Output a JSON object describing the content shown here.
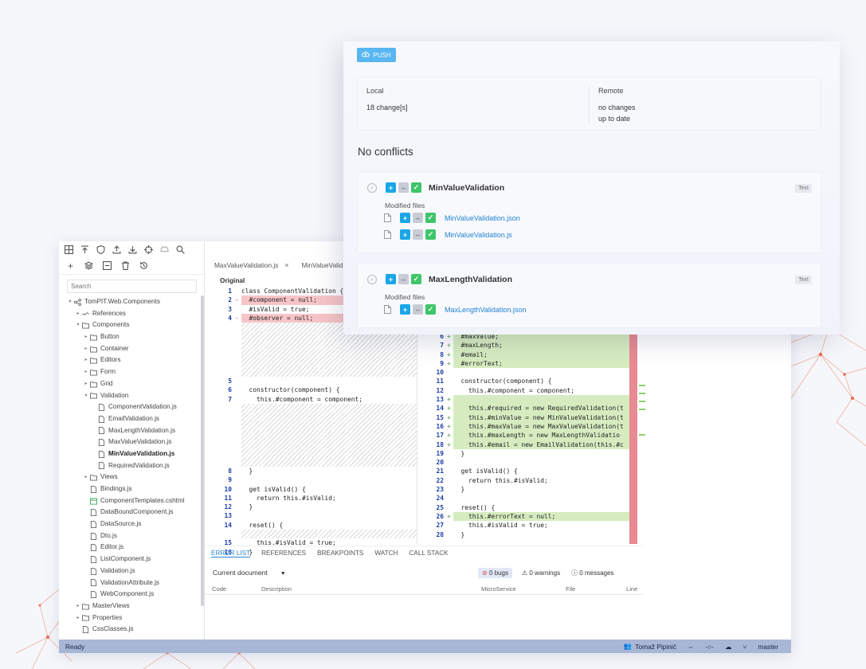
{
  "ide": {
    "search_placeholder": "Search",
    "tree": [
      {
        "label": "TomPIT.Web.Components",
        "indent": 0,
        "caret": "▾",
        "icon": "share-icon"
      },
      {
        "label": "References",
        "indent": 1,
        "caret": "▸",
        "icon": "link-icon"
      },
      {
        "label": "Components",
        "indent": 1,
        "caret": "▾",
        "icon": "folder-icon"
      },
      {
        "label": "Button",
        "indent": 2,
        "caret": "▸",
        "icon": "folder-icon"
      },
      {
        "label": "Container",
        "indent": 2,
        "caret": "▸",
        "icon": "folder-icon"
      },
      {
        "label": "Editors",
        "indent": 2,
        "caret": "▸",
        "icon": "folder-icon"
      },
      {
        "label": "Form",
        "indent": 2,
        "caret": "▸",
        "icon": "folder-icon"
      },
      {
        "label": "Grid",
        "indent": 2,
        "caret": "▸",
        "icon": "folder-icon"
      },
      {
        "label": "Validation",
        "indent": 2,
        "caret": "▾",
        "icon": "folder-icon"
      },
      {
        "label": "ComponentValidation.js",
        "indent": 3,
        "caret": "",
        "icon": "file-icon"
      },
      {
        "label": "EmailValidation.js",
        "indent": 3,
        "caret": "",
        "icon": "file-icon"
      },
      {
        "label": "MaxLengthValidation.js",
        "indent": 3,
        "caret": "",
        "icon": "file-icon"
      },
      {
        "label": "MaxValueValidation.js",
        "indent": 3,
        "caret": "",
        "icon": "file-icon"
      },
      {
        "label": "MinValueValidation.js",
        "indent": 3,
        "caret": "",
        "icon": "file-icon",
        "bold": true
      },
      {
        "label": "RequiredValidation.js",
        "indent": 3,
        "caret": "",
        "icon": "file-icon"
      },
      {
        "label": "Views",
        "indent": 2,
        "caret": "▸",
        "icon": "folder-icon"
      },
      {
        "label": "Bindings.js",
        "indent": 2,
        "caret": "",
        "icon": "file-icon"
      },
      {
        "label": "ComponentTemplates.cshtml",
        "indent": 2,
        "caret": "",
        "icon": "template-icon"
      },
      {
        "label": "DataBoundComponent.js",
        "indent": 2,
        "caret": "",
        "icon": "file-icon"
      },
      {
        "label": "DataSource.js",
        "indent": 2,
        "caret": "",
        "icon": "file-icon"
      },
      {
        "label": "Dto.js",
        "indent": 2,
        "caret": "",
        "icon": "file-icon"
      },
      {
        "label": "Editor.js",
        "indent": 2,
        "caret": "",
        "icon": "file-icon"
      },
      {
        "label": "ListComponent.js",
        "indent": 2,
        "caret": "",
        "icon": "file-icon"
      },
      {
        "label": "Validation.js",
        "indent": 2,
        "caret": "",
        "icon": "file-icon"
      },
      {
        "label": "ValidationAttribute.js",
        "indent": 2,
        "caret": "",
        "icon": "file-icon"
      },
      {
        "label": "WebComponent.js",
        "indent": 2,
        "caret": "",
        "icon": "file-icon"
      },
      {
        "label": "MasterViews",
        "indent": 1,
        "caret": "▸",
        "icon": "folder-icon"
      },
      {
        "label": "Properties",
        "indent": 1,
        "caret": "▸",
        "icon": "folder-icon"
      },
      {
        "label": "CssClasses.js",
        "indent": 1,
        "caret": "",
        "icon": "file-icon"
      }
    ],
    "tabs": [
      {
        "label": "MaxValueValidation.js",
        "close": "×"
      },
      {
        "label": "MinValueValida"
      }
    ],
    "original_label": "Original",
    "left_code": [
      {
        "n": "1",
        "mark": "",
        "t": "class ComponentValidation {",
        "type": "normal"
      },
      {
        "n": "2",
        "mark": "-",
        "t": "  #component = null;",
        "type": "del"
      },
      {
        "n": "3",
        "mark": "",
        "t": "  #isValid = true;",
        "type": "normal"
      },
      {
        "n": "4",
        "mark": "-",
        "t": "  #observer = null;",
        "type": "del"
      },
      {
        "n": "",
        "mark": "",
        "t": "",
        "type": "hatch"
      },
      {
        "n": "",
        "mark": "",
        "t": "",
        "type": "hatch"
      },
      {
        "n": "",
        "mark": "",
        "t": "",
        "type": "hatch"
      },
      {
        "n": "",
        "mark": "",
        "t": "",
        "type": "hatch"
      },
      {
        "n": "",
        "mark": "",
        "t": "",
        "type": "hatch"
      },
      {
        "n": "",
        "mark": "",
        "t": "",
        "type": "hatch"
      },
      {
        "n": "5",
        "mark": "",
        "t": "",
        "type": "normal"
      },
      {
        "n": "6",
        "mark": "",
        "t": "  constructor(component) {",
        "type": "normal"
      },
      {
        "n": "7",
        "mark": "",
        "t": "    this.#component = component;",
        "type": "normal"
      },
      {
        "n": "",
        "mark": "",
        "t": "",
        "type": "hatch"
      },
      {
        "n": "",
        "mark": "",
        "t": "",
        "type": "hatch"
      },
      {
        "n": "",
        "mark": "",
        "t": "",
        "type": "hatch"
      },
      {
        "n": "",
        "mark": "",
        "t": "",
        "type": "hatch"
      },
      {
        "n": "",
        "mark": "",
        "t": "",
        "type": "hatch"
      },
      {
        "n": "",
        "mark": "",
        "t": "",
        "type": "hatch"
      },
      {
        "n": "",
        "mark": "",
        "t": "",
        "type": "hatch"
      },
      {
        "n": "8",
        "mark": "",
        "t": "  }",
        "type": "normal"
      },
      {
        "n": "9",
        "mark": "",
        "t": "",
        "type": "normal"
      },
      {
        "n": "10",
        "mark": "",
        "t": "  get isValid() {",
        "type": "normal"
      },
      {
        "n": "11",
        "mark": "",
        "t": "    return this.#isValid;",
        "type": "normal"
      },
      {
        "n": "12",
        "mark": "",
        "t": "  }",
        "type": "normal"
      },
      {
        "n": "13",
        "mark": "",
        "t": "",
        "type": "normal"
      },
      {
        "n": "14",
        "mark": "",
        "t": "  reset() {",
        "type": "normal"
      },
      {
        "n": "",
        "mark": "",
        "t": "",
        "type": "hatch"
      },
      {
        "n": "15",
        "mark": "",
        "t": "    this.#isValid = true;",
        "type": "normal"
      },
      {
        "n": "16",
        "mark": "",
        "t": "  }",
        "type": "normal"
      }
    ],
    "right_code": [
      {
        "n": "6",
        "mark": "+",
        "t": "  #maxValue;",
        "type": "add"
      },
      {
        "n": "7",
        "mark": "+",
        "t": "  #maxLength;",
        "type": "add"
      },
      {
        "n": "8",
        "mark": "+",
        "t": "  #email;",
        "type": "add"
      },
      {
        "n": "9",
        "mark": "+",
        "t": "  #errorText;",
        "type": "add"
      },
      {
        "n": "10",
        "mark": "",
        "t": "",
        "type": "normal"
      },
      {
        "n": "11",
        "mark": "",
        "t": "  constructor(component) {",
        "type": "normal"
      },
      {
        "n": "12",
        "mark": "",
        "t": "    this.#component = component;",
        "type": "normal"
      },
      {
        "n": "13",
        "mark": "+",
        "t": "",
        "type": "add"
      },
      {
        "n": "14",
        "mark": "+",
        "t": "    this.#required = new RequiredValidation(t",
        "type": "add"
      },
      {
        "n": "15",
        "mark": "+",
        "t": "    this.#minValue = new MinValueValidation(t",
        "type": "add"
      },
      {
        "n": "16",
        "mark": "+",
        "t": "    this.#maxValue = new MaxValueValidation(t",
        "type": "add"
      },
      {
        "n": "17",
        "mark": "+",
        "t": "    this.#maxLength = new MaxLengthValidatio",
        "type": "add"
      },
      {
        "n": "18",
        "mark": "+",
        "t": "    this.#email = new EmailValidation(this.#c",
        "type": "add"
      },
      {
        "n": "19",
        "mark": "",
        "t": "  }",
        "type": "normal"
      },
      {
        "n": "20",
        "mark": "",
        "t": "",
        "type": "normal"
      },
      {
        "n": "21",
        "mark": "",
        "t": "  get isValid() {",
        "type": "normal"
      },
      {
        "n": "22",
        "mark": "",
        "t": "    return this.#isValid;",
        "type": "normal"
      },
      {
        "n": "23",
        "mark": "",
        "t": "  }",
        "type": "normal"
      },
      {
        "n": "24",
        "mark": "",
        "t": "",
        "type": "normal"
      },
      {
        "n": "25",
        "mark": "",
        "t": "  reset() {",
        "type": "normal"
      },
      {
        "n": "26",
        "mark": "+",
        "t": "    this.#errorText = null;",
        "type": "add"
      },
      {
        "n": "27",
        "mark": "",
        "t": "    this.#isValid = true;",
        "type": "normal"
      },
      {
        "n": "28",
        "mark": "",
        "t": "  }",
        "type": "normal"
      }
    ],
    "bottom_tabs": [
      "ERROR LIST",
      "REFERENCES",
      "BREAKPOINTS",
      "WATCH",
      "CALL STACK"
    ],
    "scope": "Current document",
    "bugs": "0 bugs",
    "warnings": "0 warnings",
    "messages": "0 messages",
    "columns": {
      "code": "Code",
      "description": "Description",
      "microservice": "MicroService",
      "file": "File",
      "line": "Line"
    },
    "status": {
      "ready": "Ready",
      "user": "Tomaž Pipinič",
      "branch": "master"
    }
  },
  "panel": {
    "push_label": "PUSH",
    "local_title": "Local",
    "local_changes": "18 change[s]",
    "remote_title": "Remote",
    "remote_line1": "no changes",
    "remote_line2": "up to date",
    "conflicts": "No conflicts",
    "cards": [
      {
        "title": "MinValueValidation",
        "badge": "Text",
        "modified_label": "Modified files",
        "files": [
          "MinValueValidation.json",
          "MinValueValidation.js"
        ]
      },
      {
        "title": "MaxLengthValidation",
        "badge": "Text",
        "modified_label": "Modified files",
        "files": [
          "MaxLengthValidation.json"
        ]
      }
    ],
    "btn_add": "+",
    "btn_swap": "↔",
    "btn_ok": "✓"
  },
  "colors": {
    "accent": "#58b6f0",
    "link": "#2384d3",
    "deleted": "#f7c5c8",
    "added": "#d6ecc0",
    "statusbar": "#a9b7d7",
    "network": "#ef6a4f"
  }
}
